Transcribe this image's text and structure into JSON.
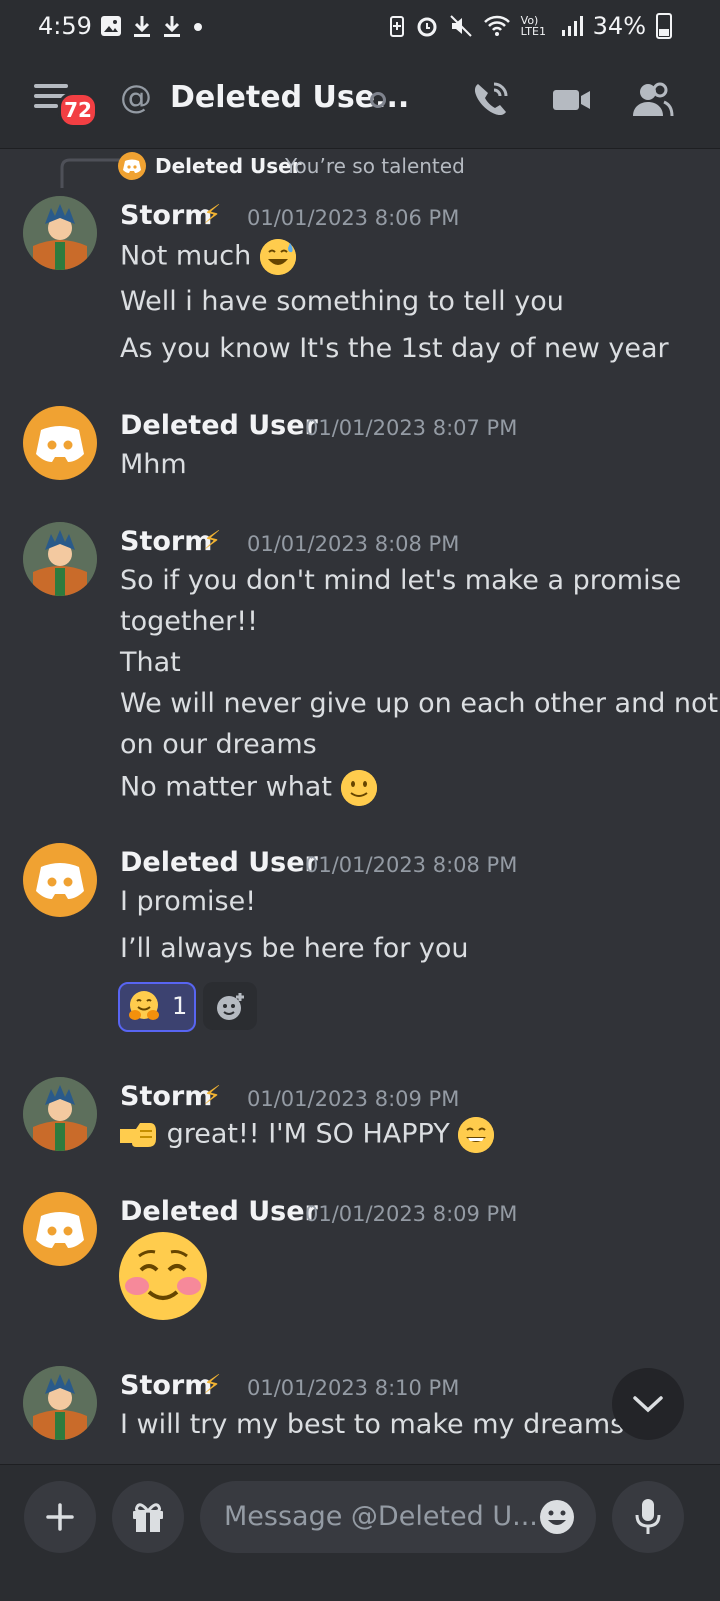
{
  "status_bar": {
    "time": "4:59",
    "battery_percent": "34%",
    "network": "Vo) LTE1"
  },
  "header": {
    "title": "Deleted Use...",
    "unread_badge": "72"
  },
  "reply_preview": {
    "author": "Deleted User",
    "text": "You’re so talented"
  },
  "messages": [
    {
      "author": "Storm",
      "author_suffix": "⚡",
      "timestamp": "01/01/2023 8:06 PM",
      "lines": [
        "Not much",
        "Well i have something to tell you",
        "As you know It's the 1st day of new year"
      ]
    },
    {
      "author": "Deleted User",
      "timestamp": "01/01/2023 8:07 PM",
      "lines": [
        "Mhm"
      ]
    },
    {
      "author": "Storm",
      "author_suffix": "⚡",
      "timestamp": "01/01/2023 8:08 PM",
      "lines": [
        "So if you don't mind let's make a promise",
        "together!!",
        "That",
        "We will never give up on each other and not",
        "on our dreams",
        "No matter what"
      ]
    },
    {
      "author": "Deleted User",
      "timestamp": "01/01/2023 8:08 PM",
      "lines": [
        "I promise!",
        "I’ll always be here for you"
      ],
      "reaction_count": "1"
    },
    {
      "author": "Storm",
      "author_suffix": "⚡",
      "timestamp": "01/01/2023 8:09 PM",
      "lines": [
        "great!! I'M SO HAPPY"
      ]
    },
    {
      "author": "Deleted User",
      "timestamp": "01/01/2023 8:09 PM",
      "lines": [
        ""
      ]
    },
    {
      "author": "Storm",
      "author_suffix": "⚡",
      "timestamp": "01/01/2023 8:10 PM",
      "lines": [
        "I will try my best to make my dreams co"
      ]
    }
  ],
  "composer": {
    "placeholder": "Message @Deleted U..."
  }
}
